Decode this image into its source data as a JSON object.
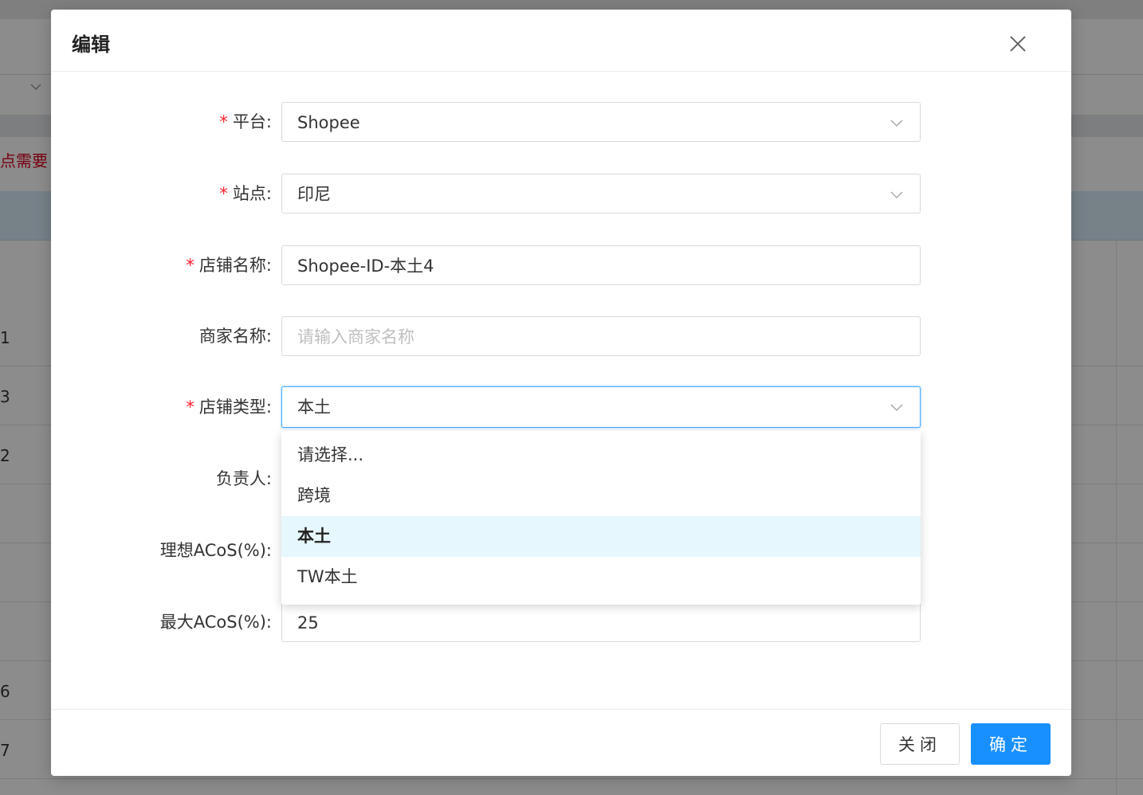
{
  "background": {
    "notice_text": "点需要",
    "row_numbers": [
      "1",
      "3",
      "2",
      "",
      "",
      "",
      "6",
      "7"
    ]
  },
  "modal": {
    "title": "编辑",
    "close_icon": "close-icon",
    "fields": {
      "platform": {
        "label": "平台:",
        "required": true,
        "value": "Shopee"
      },
      "site": {
        "label": "站点:",
        "required": true,
        "value": "印尼"
      },
      "store_name": {
        "label": "店铺名称:",
        "required": true,
        "value": "Shopee-ID-本土4"
      },
      "merchant_name": {
        "label": "商家名称:",
        "required": false,
        "placeholder": "请输入商家名称"
      },
      "store_type": {
        "label": "店铺类型:",
        "required": true,
        "value": "本土"
      },
      "owner": {
        "label": "负责人:",
        "required": false
      },
      "ideal_acos": {
        "label": "理想ACoS(%):",
        "required": false
      },
      "max_acos": {
        "label": "最大ACoS(%):",
        "required": false,
        "value": "25"
      }
    },
    "required_mark": "*",
    "store_type_options": [
      "请选择...",
      "跨境",
      "本土",
      "TW本土"
    ],
    "store_type_selected": "本土",
    "buttons": {
      "close": "关闭",
      "confirm": "确定"
    }
  },
  "colors": {
    "primary": "#1890ff",
    "required": "#f5222d",
    "selected_bg": "#e6f7fd"
  }
}
